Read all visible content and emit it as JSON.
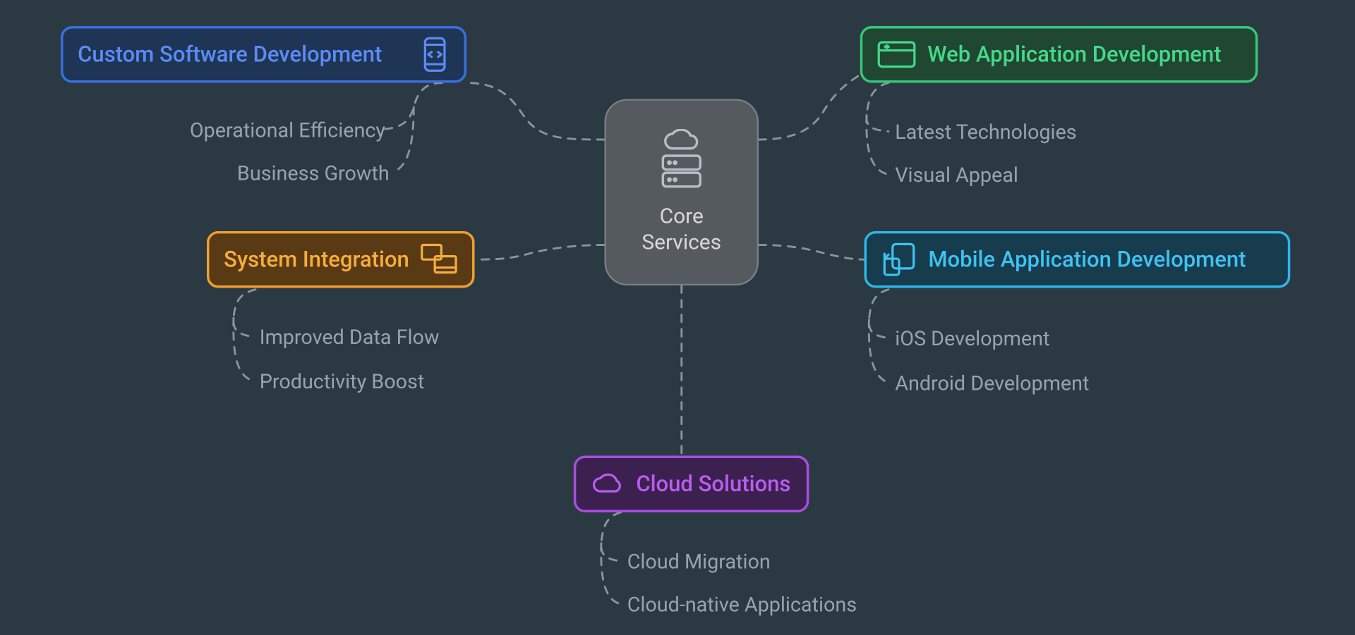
{
  "center": {
    "label": "Core\nServices"
  },
  "branches": {
    "custom": {
      "title": "Custom Software Development",
      "subs": [
        "Operational Efficiency",
        "Business Growth"
      ],
      "color": "blue"
    },
    "web": {
      "title": "Web Application Development",
      "subs": [
        "Latest Technologies",
        "Visual Appeal"
      ],
      "color": "green"
    },
    "system": {
      "title": "System Integration",
      "subs": [
        "Improved Data Flow",
        "Productivity Boost"
      ],
      "color": "orange"
    },
    "mobile": {
      "title": "Mobile Application Development",
      "subs": [
        "iOS Development",
        "Android Development"
      ],
      "color": "cyan"
    },
    "cloud": {
      "title": "Cloud Solutions",
      "subs": [
        "Cloud Migration",
        "Cloud-native Applications"
      ],
      "color": "purple"
    }
  },
  "colors": {
    "blue": "#3b6fe0",
    "green": "#36c77a",
    "orange": "#f0a030",
    "cyan": "#2fb6e8",
    "purple": "#a94de0",
    "gray": "#8a949e"
  }
}
